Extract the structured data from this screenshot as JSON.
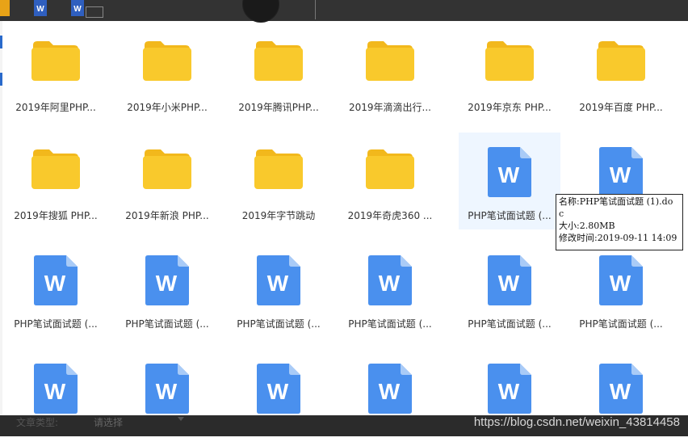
{
  "colors": {
    "folder": "#f9c92c",
    "folder_tab": "#f2b81c",
    "word_blue": "#4a90ee",
    "word_fold": "#a9cbf7",
    "hover_bg": "#eef6ff",
    "topbar": "#333333",
    "bottombar": "#2b2b2b"
  },
  "files": [
    {
      "type": "folder",
      "label": "2019年阿里PHP..."
    },
    {
      "type": "folder",
      "label": "2019年小米PHP..."
    },
    {
      "type": "folder",
      "label": "2019年腾讯PHP..."
    },
    {
      "type": "folder",
      "label": "2019年滴滴出行..."
    },
    {
      "type": "folder",
      "label": "2019年京东 PHP..."
    },
    {
      "type": "folder",
      "label": "2019年百度 PHP..."
    },
    {
      "type": "folder",
      "label": "2019年搜狐 PHP..."
    },
    {
      "type": "folder",
      "label": "2019年新浪 PHP..."
    },
    {
      "type": "folder",
      "label": "2019年字节跳动"
    },
    {
      "type": "folder",
      "label": "2019年奇虎360 ..."
    },
    {
      "type": "word",
      "label": "PHP笔试面试题 (...",
      "hovered": true
    },
    {
      "type": "word",
      "label": ""
    },
    {
      "type": "word",
      "label": "PHP笔试面试题 (..."
    },
    {
      "type": "word",
      "label": "PHP笔试面试题 (..."
    },
    {
      "type": "word",
      "label": "PHP笔试面试题 (..."
    },
    {
      "type": "word",
      "label": "PHP笔试面试题 (..."
    },
    {
      "type": "word",
      "label": "PHP笔试面试题 (..."
    },
    {
      "type": "word",
      "label": "PHP笔试面试题 (..."
    },
    {
      "type": "word",
      "label": ""
    },
    {
      "type": "word",
      "label": ""
    },
    {
      "type": "word",
      "label": ""
    },
    {
      "type": "word",
      "label": ""
    },
    {
      "type": "word",
      "label": ""
    },
    {
      "type": "word",
      "label": ""
    }
  ],
  "word_letter": "W",
  "tooltip": {
    "name_line": "名称:PHP笔试面试题 (1).do",
    "name_wrap": "c",
    "size_line": "大小:2.80MB",
    "modified_line": "修改时间:2019-09-11 14:09"
  },
  "bottom": {
    "label": "文章类型:",
    "select_value": "请选择"
  },
  "watermark": "https://blog.csdn.net/weixin_43814458"
}
